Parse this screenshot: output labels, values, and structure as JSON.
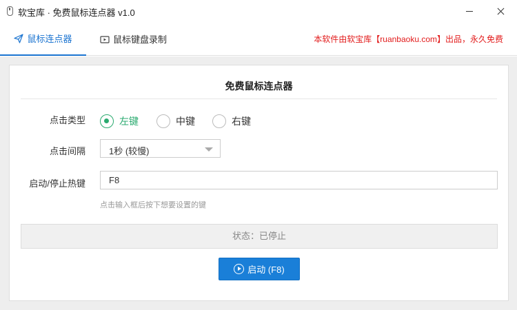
{
  "window": {
    "title": "软宝库 · 免费鼠标连点器 v1.0"
  },
  "tabs": [
    {
      "label": "鼠标连点器",
      "icon": "paper-plane-icon",
      "active": true
    },
    {
      "label": "鼠标键盘录制",
      "icon": "video-icon",
      "active": false
    }
  ],
  "notice": "本软件由软宝库【ruanbaoku.com】出品，永久免费",
  "panel": {
    "title": "免费鼠标连点器",
    "click_type": {
      "label": "点击类型",
      "options": [
        "左键",
        "中键",
        "右键"
      ],
      "selected": "左键"
    },
    "interval": {
      "label": "点击间隔",
      "value": "1秒 (较慢)"
    },
    "hotkey": {
      "label": "启动/停止热键",
      "value": "F8",
      "hint": "点击输入框后按下想要设置的键"
    },
    "status": "状态：已停止",
    "start_button": "启动 (F8)"
  },
  "colors": {
    "accent": "#1a73d0",
    "radio_selected": "#2aaa6f",
    "notice": "#e21b1b",
    "button": "#1a7fd8"
  }
}
